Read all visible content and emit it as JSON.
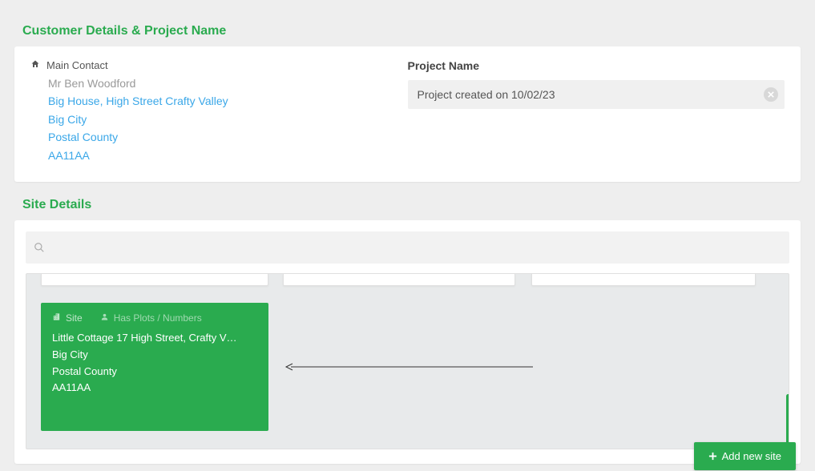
{
  "sections": {
    "customer_title": "Customer Details & Project Name",
    "site_title": "Site Details"
  },
  "contact": {
    "label": "Main Contact",
    "name": "Mr Ben Woodford",
    "address1": "Big House, High Street Crafty Valley",
    "city": "Big City",
    "county": "Postal County",
    "postcode": "AA11AA"
  },
  "project": {
    "label": "Project Name",
    "value": "Project created on 10/02/23"
  },
  "search": {
    "placeholder": ""
  },
  "site_tile": {
    "site_label": "Site",
    "plots_label": "Has Plots / Numbers",
    "address1": "Little Cottage 17 High Street, Crafty V…",
    "city": "Big City",
    "county": "Postal County",
    "postcode": "AA11AA"
  },
  "buttons": {
    "add_site": "Add new site"
  }
}
